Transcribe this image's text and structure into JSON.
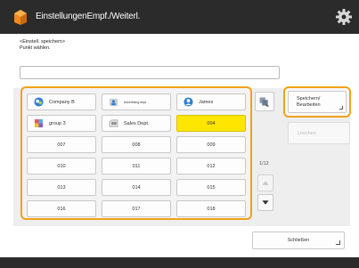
{
  "window": {
    "title": "EinstellungenEmpf./Weiterl."
  },
  "instructions": {
    "line1": "<Einstell. speichern>",
    "line2": "Punkt wählen."
  },
  "grid": {
    "rows": [
      [
        {
          "label": "Company B",
          "icon": "group-icon"
        },
        {
          "label": "Advertising dept",
          "icon": "folder-person-icon"
        },
        {
          "label": "James",
          "icon": "person-icon"
        }
      ],
      [
        {
          "label": "group 3",
          "icon": "colored-folder-icon"
        },
        {
          "label": "Sales Dept.",
          "icon": "folder-group-icon"
        },
        {
          "label": "004",
          "icon": "",
          "selected": true
        }
      ],
      [
        {
          "label": "007"
        },
        {
          "label": "008"
        },
        {
          "label": "009"
        }
      ],
      [
        {
          "label": "010"
        },
        {
          "label": "011"
        },
        {
          "label": "012"
        }
      ],
      [
        {
          "label": "013"
        },
        {
          "label": "014"
        },
        {
          "label": "015"
        }
      ],
      [
        {
          "label": "016"
        },
        {
          "label": "017"
        },
        {
          "label": "018"
        }
      ]
    ]
  },
  "pager": {
    "indicator": "1/12"
  },
  "buttons": {
    "save_line1": "Speichern/",
    "save_line2": "Bearbeiten",
    "delete": "Löschen",
    "close": "Schließen"
  },
  "colors": {
    "highlight": "#f0a21a",
    "selected": "#ffe600",
    "titlebar": "#2b2b2b"
  }
}
